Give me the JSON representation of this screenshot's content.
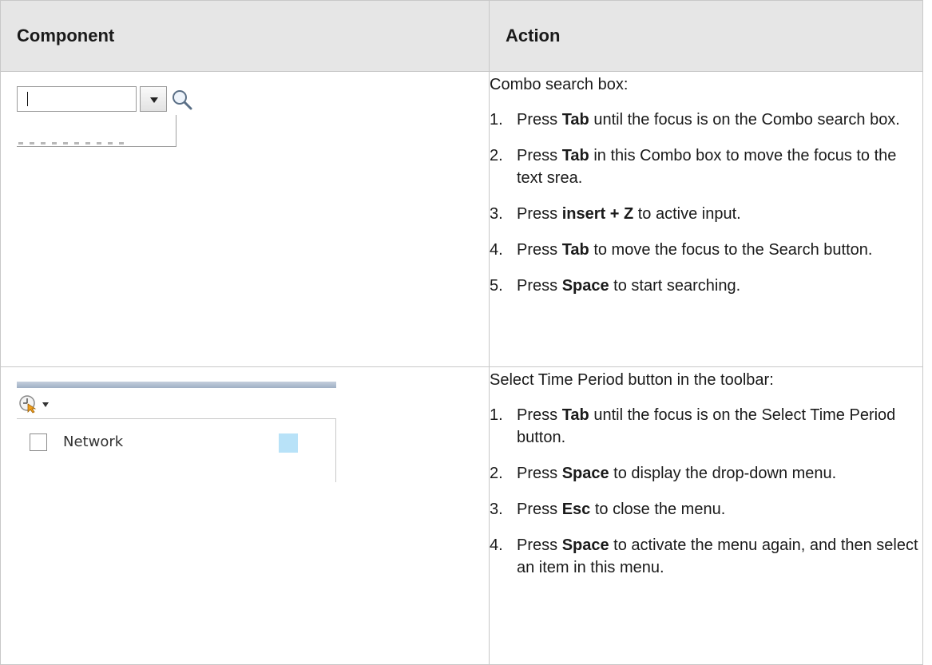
{
  "headers": {
    "component": "Component",
    "action": "Action"
  },
  "rows": [
    {
      "component": {
        "combo_icon": "dropdown-arrow-icon",
        "search_icon": "magnifier-icon"
      },
      "intro": "Combo search box:",
      "steps": [
        {
          "n": "1.",
          "a": "Press ",
          "key": "Tab",
          "b": " until the focus is on the Combo search box."
        },
        {
          "n": "2.",
          "a": "Press ",
          "key": "Tab",
          "b": " in this Combo box to move the focus to the text srea."
        },
        {
          "n": "3.",
          "a": "Press ",
          "key": "insert + Z",
          "b": " to active input."
        },
        {
          "n": "4.",
          "a": "Press ",
          "key": "Tab",
          "b": " to move the focus to the Search button."
        },
        {
          "n": "5.",
          "a": "Press ",
          "key": "Space",
          "b": " to start searching."
        }
      ]
    },
    {
      "component": {
        "time_icon": "clock-cursor-icon",
        "checkbox_label": "Network",
        "swatch_color": "#b8e2f8"
      },
      "intro": "Select Time Period button in the toolbar:",
      "steps": [
        {
          "n": "1.",
          "a": "Press ",
          "key": "Tab",
          "b": " until the focus is on the Select Time Period button."
        },
        {
          "n": "2.",
          "a": "Press ",
          "key": "Space",
          "b": " to display the drop-down menu."
        },
        {
          "n": "3.",
          "a": "Press ",
          "key": "Esc",
          "b": " to close the menu."
        },
        {
          "n": "4.",
          "a": "Press ",
          "key": "Space",
          "b": " to activate the menu again, and then select an item in this menu."
        }
      ]
    }
  ]
}
